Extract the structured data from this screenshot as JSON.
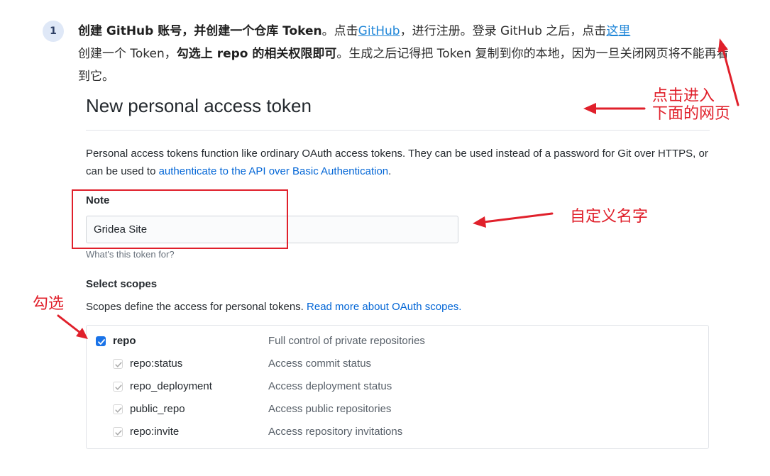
{
  "step": {
    "number": "1",
    "seg1_bold": "创建 GitHub 账号，并创建一个仓库 Token",
    "seg2": "。点击",
    "link_github": "GitHub",
    "seg3": "，进行注册。登录 GitHub 之后，点击",
    "link_here": "这里",
    "seg4": "创建一个 Token，",
    "seg5_bold": "勾选上 repo 的相关权限即可",
    "seg6": "。生成之后记得把 Token 复制到你的本地，因为一旦关闭网页将不能再看到它。"
  },
  "page": {
    "heading": "New personal access token",
    "desc_text": "Personal access tokens function like ordinary OAuth access tokens. They can be used instead of a password for Git over HTTPS, or can be used to ",
    "desc_link": "authenticate to the API over Basic Authentication",
    "desc_end": "."
  },
  "note": {
    "label": "Note",
    "value": "Gridea Site",
    "hint": "What's this token for?"
  },
  "scopes": {
    "label": "Select scopes",
    "desc_text": "Scopes define the access for personal tokens. ",
    "desc_link": "Read more about OAuth scopes.",
    "items": [
      {
        "name": "repo",
        "desc": "Full control of private repositories",
        "checked": true
      },
      {
        "name": "repo:status",
        "desc": "Access commit status",
        "checked": true
      },
      {
        "name": "repo_deployment",
        "desc": "Access deployment status",
        "checked": true
      },
      {
        "name": "public_repo",
        "desc": "Access public repositories",
        "checked": true
      },
      {
        "name": "repo:invite",
        "desc": "Access repository invitations",
        "checked": true
      }
    ]
  },
  "annotations": {
    "click_enter_line1": "点击进入",
    "click_enter_line2": "下面的网页",
    "custom_name": "自定义名字",
    "check": "勾选"
  },
  "colors": {
    "annotation_red": "#e0202b",
    "link_blue": "#0366d6",
    "checkbox_blue": "#1a73e8"
  }
}
